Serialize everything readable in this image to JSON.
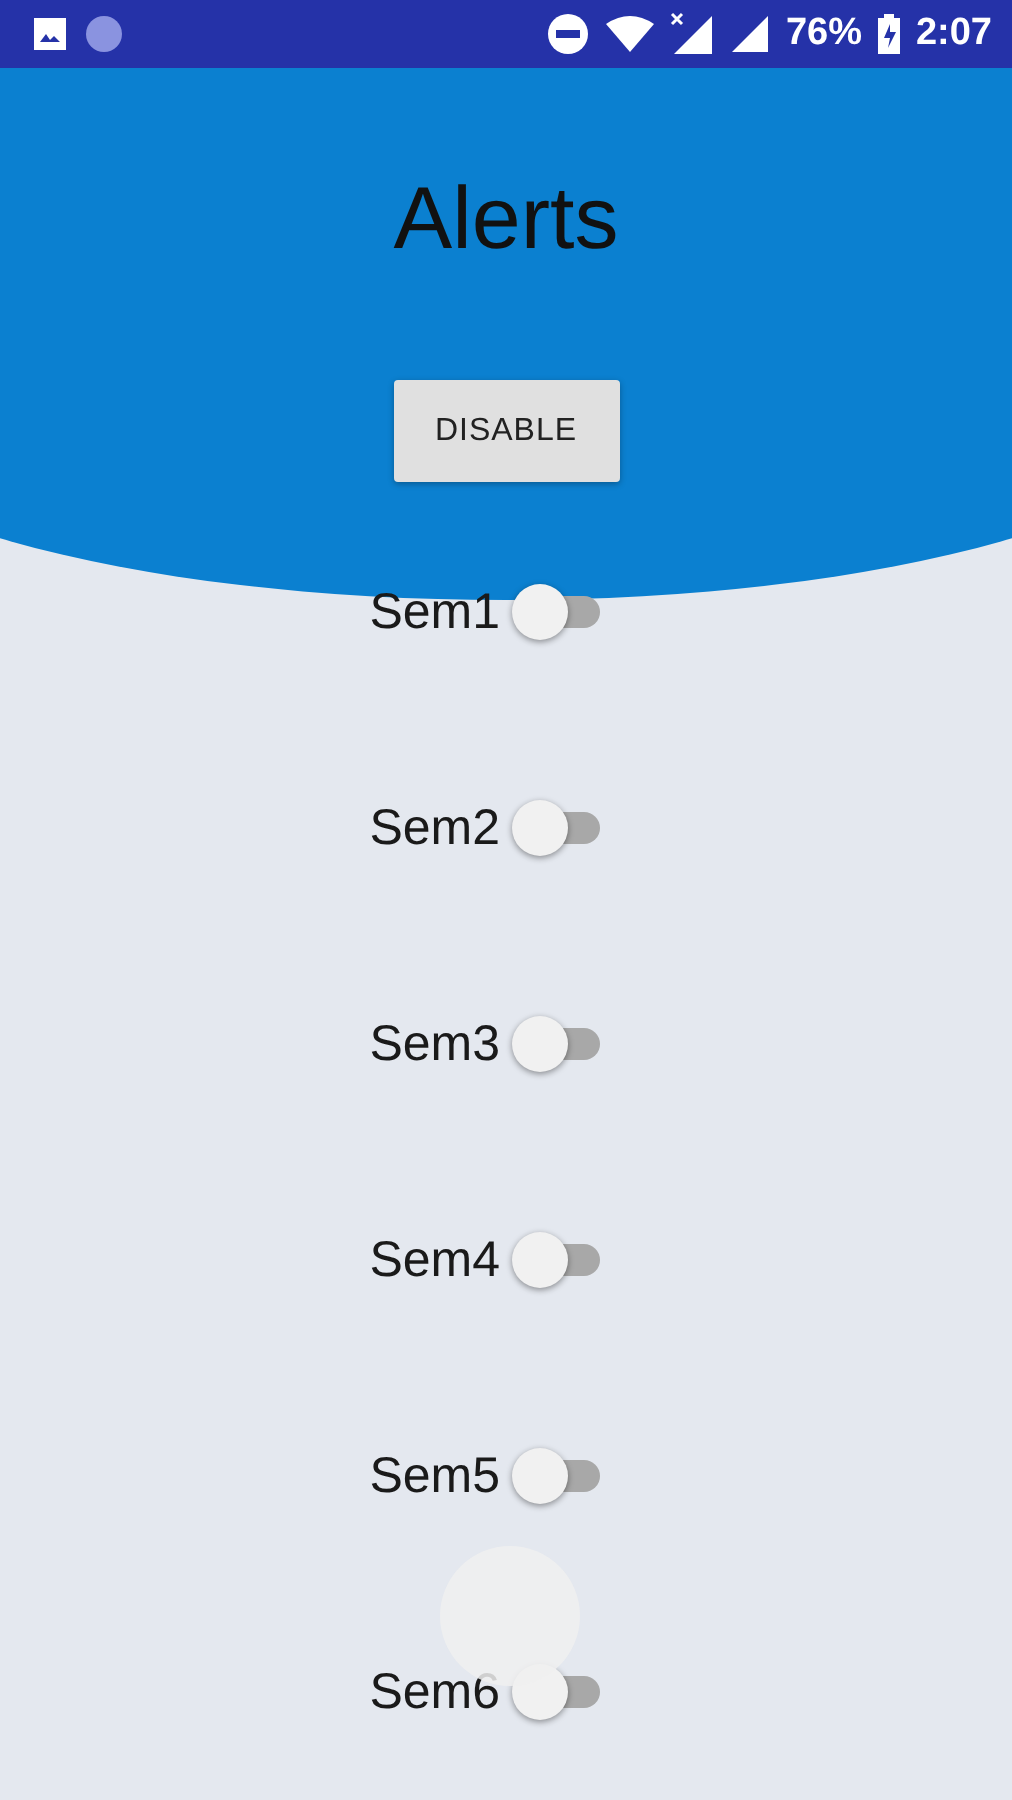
{
  "status_bar": {
    "battery": "76%",
    "time": "2:07"
  },
  "header": {
    "title": "Alerts",
    "button": "DISABLE"
  },
  "alerts": [
    {
      "label": "Sem1",
      "on": false
    },
    {
      "label": "Sem2",
      "on": false
    },
    {
      "label": "Sem3",
      "on": false
    },
    {
      "label": "Sem4",
      "on": false
    },
    {
      "label": "Sem5",
      "on": false
    },
    {
      "label": "Sem6",
      "on": false,
      "pressed": true
    }
  ]
}
